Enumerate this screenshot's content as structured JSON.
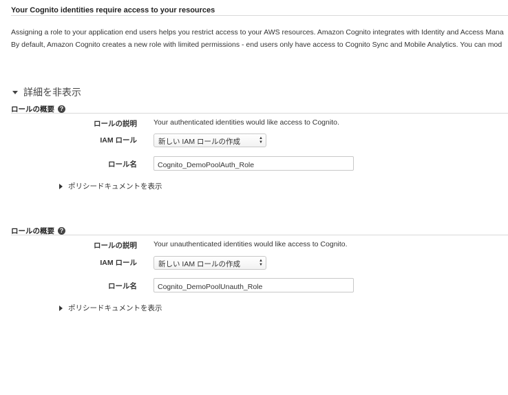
{
  "header": {
    "title": "Your Cognito identities require access to your resources",
    "desc_line1": "Assigning a role to your application end users helps you restrict access to your AWS resources. Amazon Cognito integrates with Identity and Access Mana",
    "desc_line2": "By default, Amazon Cognito creates a new role with limited permissions - end users only have access to Cognito Sync and Mobile Analytics. You can mod"
  },
  "details_toggle": {
    "label": "詳細を非表示"
  },
  "sections": [
    {
      "title": "ロールの概要",
      "description_label": "ロールの説明",
      "description_value": "Your authenticated identities would like access to Cognito.",
      "iam_role_label": "IAM ロール",
      "iam_role_value": "新しい IAM ロールの作成",
      "role_name_label": "ロール名",
      "role_name_value": "Cognito_DemoPoolAuth_Role",
      "policy_link": "ポリシードキュメントを表示"
    },
    {
      "title": "ロールの概要",
      "description_label": "ロールの説明",
      "description_value": "Your unauthenticated identities would like access to Cognito.",
      "iam_role_label": "IAM ロール",
      "iam_role_value": "新しい IAM ロールの作成",
      "role_name_label": "ロール名",
      "role_name_value": "Cognito_DemoPoolUnauth_Role",
      "policy_link": "ポリシードキュメントを表示"
    }
  ],
  "icons": {
    "help": "question-circle-icon",
    "select": "up-down-arrows-icon",
    "collapse": "caret-down-icon",
    "expand": "caret-right-icon"
  }
}
